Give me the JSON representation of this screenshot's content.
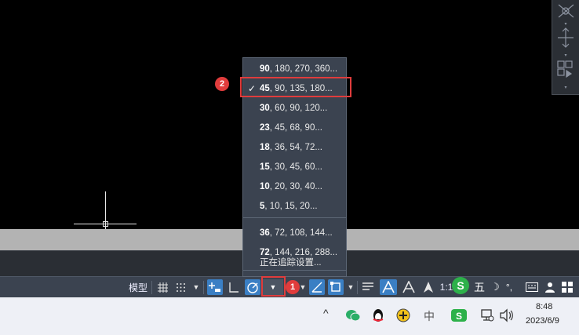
{
  "menu": {
    "items": [
      {
        "lead": "90",
        "rest": ", 180, 270, 360...",
        "checked": false
      },
      {
        "lead": "45",
        "rest": ", 90, 135, 180...",
        "checked": true
      },
      {
        "lead": "30",
        "rest": ", 60, 90, 120...",
        "checked": false
      },
      {
        "lead": "23",
        "rest": ", 45, 68, 90...",
        "checked": false
      },
      {
        "lead": "18",
        "rest": ", 36, 54, 72...",
        "checked": false
      },
      {
        "lead": "15",
        "rest": ", 30, 45, 60...",
        "checked": false
      },
      {
        "lead": "10",
        "rest": ", 20, 30, 40...",
        "checked": false
      },
      {
        "lead": "5",
        "rest": ", 10, 15, 20...",
        "checked": false
      },
      {
        "lead": "36",
        "rest": ", 72, 108, 144...",
        "checked": false
      },
      {
        "lead": "72",
        "rest": ", 144, 216, 288...",
        "checked": false
      }
    ],
    "settings_label": "正在追踪设置...",
    "check_glyph": "✓"
  },
  "callouts": {
    "one": "1",
    "two": "2"
  },
  "statusbar": {
    "model_label": "模型",
    "scale_label": "1:1"
  },
  "ime": {
    "label": "五"
  },
  "tray": {
    "chinese_label": "中"
  },
  "clock": {
    "time": "8:48",
    "date": "2023/6/9"
  },
  "colors": {
    "accent": "#3a7fc4",
    "callout_red": "#e03c3c",
    "menu_bg": "#3b4350"
  }
}
